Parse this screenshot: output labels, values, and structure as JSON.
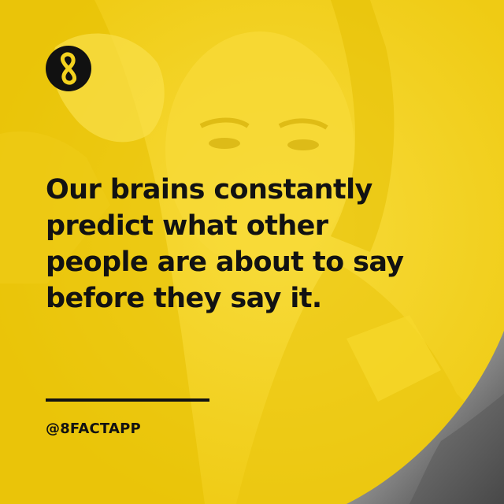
{
  "brand": {
    "logo_icon": "infinity-eight-icon",
    "logo_color": "#111111",
    "handle": "@8FACTAPP"
  },
  "fact": {
    "lines": [
      "Our brains constantly",
      "predict what other",
      "people are about to say",
      "before they say it."
    ]
  },
  "colors": {
    "background": "#f4d21e",
    "text": "#121212"
  }
}
